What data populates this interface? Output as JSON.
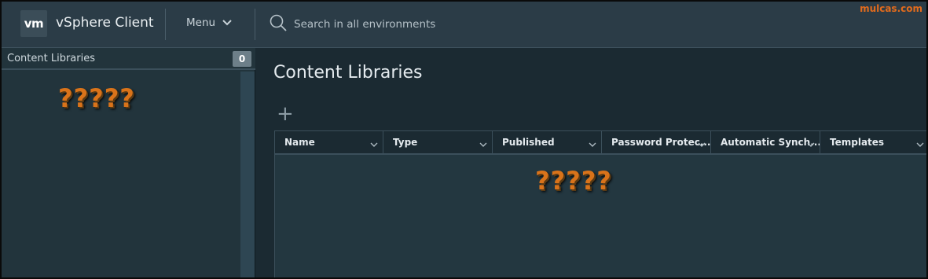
{
  "header": {
    "logo_text": "vm",
    "app_title": "vSphere Client",
    "menu_label": "Menu",
    "search_placeholder": "Search in all environments"
  },
  "watermark": "mulcas.com",
  "left_panel": {
    "title": "Content Libraries",
    "count": "0",
    "placeholder_text": "?????"
  },
  "main": {
    "title": "Content Libraries",
    "add_symbol": "+",
    "columns": [
      {
        "label": "Name"
      },
      {
        "label": "Type"
      },
      {
        "label": "Published"
      },
      {
        "label": "Password Protec..."
      },
      {
        "label": "Automatic Synch..."
      },
      {
        "label": "Templates"
      }
    ],
    "grid_placeholder_text": "?????"
  },
  "colors": {
    "header_bg": "#2b3c47",
    "panel_bg": "#22343c",
    "main_bg": "#1b2a32",
    "accent_orange": "#d9731a"
  }
}
